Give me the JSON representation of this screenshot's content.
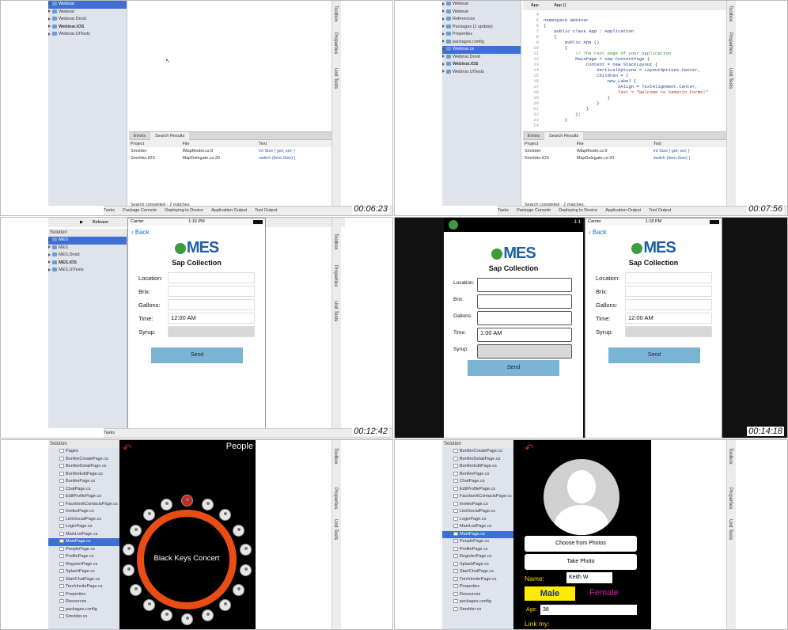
{
  "timestamps": [
    "00:06:23",
    "00:07:56",
    "00:12:42",
    "00:14:18"
  ],
  "p1": {
    "solution": [
      {
        "label": "Webinar",
        "sel": true
      },
      {
        "label": "Webinar"
      },
      {
        "label": "Webinar.Droid"
      },
      {
        "label": "Webinar.iOS",
        "bold": true
      },
      {
        "label": "Webinar.UITests"
      }
    ],
    "tabs": [
      "Errors",
      "Search Results"
    ],
    "cols": [
      "Project",
      "File",
      "Text"
    ],
    "rows": [
      [
        "Smolder",
        "IMapModel.cs:9",
        "int Size { get; set; }"
      ],
      [
        "Smolder.iOS",
        "MapDelegate.cs:20",
        "switch (item.Size) {"
      ]
    ],
    "footer": "Search completed - 2 matches.",
    "status": [
      "Tasks",
      "Package Console",
      "Deploying to Device",
      "Application Output",
      "Tool Output"
    ],
    "side": [
      "Toolbox",
      "Properties",
      "Unit Tests"
    ]
  },
  "p2": {
    "toolbar": [
      "App",
      "App ()"
    ],
    "solution": [
      {
        "label": "Webinar"
      },
      {
        "label": "Webinar"
      },
      {
        "label": "References"
      },
      {
        "label": "Packages (1 update)"
      },
      {
        "label": "Properties"
      },
      {
        "label": "packages.config"
      },
      {
        "label": "Webinar.cs",
        "sel": true
      },
      {
        "label": "Webinar.Droid"
      },
      {
        "label": "Webinar.iOS",
        "bold": true
      },
      {
        "label": "Webinar.UITests"
      }
    ],
    "code": [
      [
        "4",
        ""
      ],
      [
        "5",
        "namespace Webinar"
      ],
      [
        "6",
        "{"
      ],
      [
        "7",
        "    public class App : Application"
      ],
      [
        "8",
        "    {"
      ],
      [
        "9",
        "        public App ()"
      ],
      [
        "10",
        "        {"
      ],
      [
        "11",
        "            // The root page of your application"
      ],
      [
        "12",
        "            MainPage = new ContentPage {"
      ],
      [
        "13",
        "                Content = new StackLayout {"
      ],
      [
        "14",
        "                    VerticalOptions = LayoutOptions.Center,"
      ],
      [
        "15",
        "                    Children = {"
      ],
      [
        "16",
        "                        new Label {"
      ],
      [
        "17",
        "                            XAlign = TextAlignment.Center,"
      ],
      [
        "18",
        "                            Text = \"Welcome to Xamarin Forms!\""
      ],
      [
        "19",
        "                        }"
      ],
      [
        "20",
        "                    }"
      ],
      [
        "21",
        "                }"
      ],
      [
        "22",
        "            };"
      ],
      [
        "23",
        "        }"
      ],
      [
        "24",
        ""
      ]
    ]
  },
  "p3": {
    "toolbar": "Release",
    "solution_header": "Solution",
    "solution": [
      {
        "label": "MES",
        "sel": true
      },
      {
        "label": "MES"
      },
      {
        "label": "MES.Droid"
      },
      {
        "label": "MES.iOS",
        "bold": true
      },
      {
        "label": "MES.UITests"
      }
    ],
    "carrier": "Carrier",
    "time": "1:16 PM",
    "back": "Back",
    "logo": "MES",
    "title": "Sap Collection",
    "fields": [
      {
        "label": "Location:",
        "value": ""
      },
      {
        "label": "Brix:",
        "value": ""
      },
      {
        "label": "Gallons:",
        "value": ""
      },
      {
        "label": "Time:",
        "value": "12:00 AM"
      },
      {
        "label": "Syrup:",
        "value": ""
      }
    ],
    "send": "Send"
  },
  "p4": {
    "android": {
      "clock": "1:1",
      "logo": "MES",
      "title": "Sap Collection",
      "fields": [
        {
          "label": "Location:",
          "value": ""
        },
        {
          "label": "Brix:",
          "value": ""
        },
        {
          "label": "Gallons:",
          "value": ""
        },
        {
          "label": "Time:",
          "value": "1:00 AM"
        },
        {
          "label": "Syrup:",
          "value": ""
        }
      ],
      "send": "Send"
    },
    "ios": {
      "carrier": "Carrier",
      "time": "1:18 PM",
      "back": "Back",
      "logo": "MES",
      "title": "Sap Collection",
      "fields": [
        {
          "label": "Location:",
          "value": ""
        },
        {
          "label": "Brix:",
          "value": ""
        },
        {
          "label": "Gallons:",
          "value": ""
        },
        {
          "label": "Time:",
          "value": "12:00 AM"
        },
        {
          "label": "Syrup:",
          "value": ""
        }
      ],
      "send": "Send"
    }
  },
  "p5": {
    "solution_header": "Solution",
    "toolbar": "Debug",
    "title": "People",
    "center": "Black Keys Concert",
    "files": [
      "Pages",
      "BonfireCreatePage.cs",
      "BonfireDetailPage.cs",
      "BonfireEditPage.cs",
      "BonfirePage.cs",
      "ChatPage.cs",
      "EditProfilePage.cs",
      "FacebookContactsPage.cs",
      "InvitesPage.cs",
      "LinkSocialPage.cs",
      "LoginPage.cs",
      "MainListPage.cs",
      "MainPage.cs",
      "PeoplePage.cs",
      "ProfilePage.cs",
      "RegisterPage.cs",
      "SplashPage.cs",
      "StartChatPage.cs",
      "TorchInvitePage.cs",
      "Properties",
      "Resources",
      "packages.config",
      "Smolder.cs"
    ]
  },
  "p6": {
    "solution_header": "Solution",
    "toolbar": "Debug",
    "files": [
      "BonfireCreatePage.cs",
      "BonfireDetailPage.cs",
      "BonfireEditPage.cs",
      "BonfirePage.cs",
      "ChatPage.cs",
      "EditProfilePage.cs",
      "FacebookContactsPage.cs",
      "InvitesPage.cs",
      "LinkSocialPage.cs",
      "LoginPage.cs",
      "MainListPage.cs",
      "MainPage.cs",
      "PeoplePage.cs",
      "ProfilePage.cs",
      "RegisterPage.cs",
      "SplashPage.cs",
      "StartChatPage.cs",
      "TorchInvitePage.cs",
      "Properties",
      "Resources",
      "packages.config",
      "Smolder.cs"
    ],
    "choose": "Choose from Photos",
    "take": "Take Photo",
    "name_label": "Name:",
    "name": "Keith W",
    "male": "Male",
    "female": "Female",
    "age_label": "Age:",
    "age": "38",
    "link": "Link my:"
  }
}
